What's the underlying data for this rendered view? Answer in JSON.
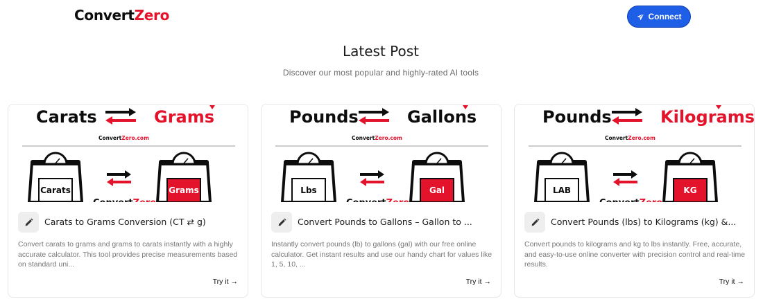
{
  "header": {
    "logo_part1": "Convert",
    "logo_part2": "Zero",
    "connect_label": "Connect"
  },
  "section": {
    "title": "Latest Post",
    "subtitle": "Discover our most popular and highly-rated AI tools"
  },
  "colors": {
    "brand_red": "#e3132b",
    "brand_blue": "#1f5ee6"
  },
  "cards": [
    {
      "img_left": "Carats",
      "img_right": "Grams",
      "img_right_red": true,
      "img_brand_a": "Convert",
      "img_brand_b": "Zero.com",
      "scale_left": "Carats",
      "scale_right": "Grams",
      "scale_brand_a": "Convert",
      "scale_brand_b": "Zero",
      "title": "Carats to Grams Conversion (CT ⇄ g)",
      "desc": "Convert carats to grams and grams to carats instantly with a highly accurate calculator. This tool provides precise measurements based on standard uni...",
      "cta": "Try it →"
    },
    {
      "img_left": "Pounds",
      "img_right": "Gallons",
      "img_right_red": false,
      "img_brand_a": "Convert",
      "img_brand_b": "Zero.com",
      "scale_left": "Lbs",
      "scale_right": "Gal",
      "scale_brand_a": "Convert",
      "scale_brand_b": "Zero",
      "title": "Convert Pounds to Gallons – Gallon to ...",
      "desc": "Instantly convert pounds (lb) to gallons (gal) with our free online calculator. Get instant results and use our handy chart for values like 1, 5, 10, ...",
      "cta": "Try it →"
    },
    {
      "img_left": "Pounds",
      "img_right": "Kilograms",
      "img_right_red": true,
      "img_brand_a": "Convert",
      "img_brand_b": "Zero.com",
      "scale_left": "LAB",
      "scale_right": "KG",
      "scale_brand_a": "Convert",
      "scale_brand_b": "Zero",
      "title": "Convert Pounds (lbs) to Kilograms (kg) &...",
      "desc": "Convert pounds to kilograms and kg to lbs instantly. Free, accurate, and easy-to-use online converter with precision control and real-time results.",
      "cta": "Try it →"
    }
  ]
}
